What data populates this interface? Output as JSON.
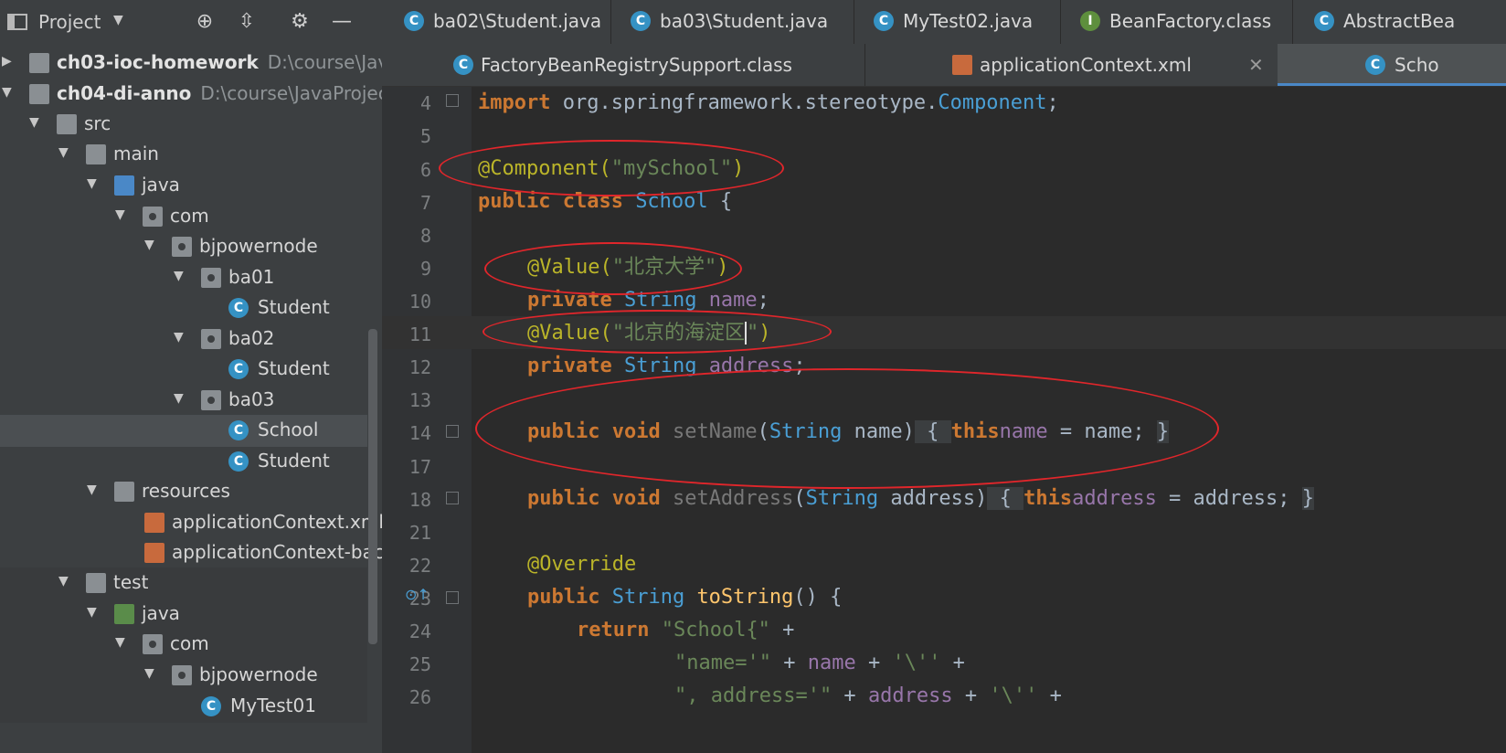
{
  "project_panel": {
    "title": "Project",
    "tree": [
      {
        "label": "ch03-ioc-homework",
        "path": "D:\\course\\JavaP",
        "kind": "module",
        "expanded": false
      },
      {
        "label": "ch04-di-anno",
        "path": "D:\\course\\JavaProjects",
        "kind": "module",
        "expanded": true
      },
      {
        "label": "src",
        "kind": "folder",
        "expanded": true
      },
      {
        "label": "main",
        "kind": "folder",
        "expanded": true
      },
      {
        "label": "java",
        "kind": "folder-source",
        "expanded": true
      },
      {
        "label": "com",
        "kind": "package",
        "expanded": true
      },
      {
        "label": "bjpowernode",
        "kind": "package",
        "expanded": true
      },
      {
        "label": "ba01",
        "kind": "package",
        "expanded": true
      },
      {
        "label": "Student",
        "kind": "class"
      },
      {
        "label": "ba02",
        "kind": "package",
        "expanded": true
      },
      {
        "label": "Student",
        "kind": "class"
      },
      {
        "label": "ba03",
        "kind": "package",
        "expanded": true
      },
      {
        "label": "School",
        "kind": "class",
        "selected": true
      },
      {
        "label": "Student",
        "kind": "class"
      },
      {
        "label": "resources",
        "kind": "folder-resources",
        "expanded": true
      },
      {
        "label": "applicationContext.xml",
        "kind": "xml"
      },
      {
        "label": "applicationContext-bac",
        "kind": "xml"
      },
      {
        "label": "test",
        "kind": "folder",
        "expanded": true
      },
      {
        "label": "java",
        "kind": "folder-test",
        "expanded": true
      },
      {
        "label": "com",
        "kind": "package",
        "expanded": true
      },
      {
        "label": "bjpowernode",
        "kind": "package",
        "expanded": true
      },
      {
        "label": "MyTest01",
        "kind": "class-test"
      }
    ]
  },
  "tabs_row1": [
    {
      "label": "ba02\\Student.java",
      "icon": "class-icon"
    },
    {
      "label": "ba03\\Student.java",
      "icon": "class-icon"
    },
    {
      "label": "MyTest02.java",
      "icon": "class-icon"
    },
    {
      "label": "BeanFactory.class",
      "icon": "interface-icon"
    },
    {
      "label": "AbstractBea",
      "icon": "class-icon"
    }
  ],
  "tabs_row2": [
    {
      "label": "FactoryBeanRegistrySupport.class",
      "icon": "class-icon"
    },
    {
      "label": "applicationContext.xml",
      "icon": "xml-icon"
    },
    {
      "label": "Scho",
      "icon": "class-icon",
      "active": true
    }
  ],
  "line_numbers": [
    "4",
    "5",
    "6",
    "7",
    "8",
    "9",
    "10",
    "11",
    "12",
    "13",
    "14",
    "17",
    "18",
    "21",
    "22",
    "23",
    "24",
    "25",
    "26"
  ],
  "code": {
    "l4": {
      "kw": "import",
      "rest": " org.springframework.stereotype.",
      "cls": "Component",
      ";": ";"
    },
    "l6": {
      "ann": "@Component(",
      "str": "\"mySchool\"",
      "end": ")"
    },
    "l7": {
      "kw": "public class ",
      "name": "School",
      " b": " {"
    },
    "l9": {
      "ann": "@Value(",
      "str": "\"北京大学\"",
      "end": ")"
    },
    "l10": {
      "kw": "private ",
      "type": "String ",
      "field": "name",
      ";": ";"
    },
    "l11": {
      "ann": "@Value(",
      "str": "\"北京的海淀区",
      "str2": "\"",
      "end": ")"
    },
    "l12": {
      "kw": "private ",
      "type": "String ",
      "field": "address",
      ";": ";"
    },
    "l14": {
      "kw": "public void ",
      "m": "setName",
      "p1": "(",
      "ptype": "String",
      " p": " name)",
      "ob": " { ",
      "this": "this",
      ".": ".",
      "fld": "name",
      " eq": " = name; ",
      "cb": "}"
    },
    "l18": {
      "kw": "public void ",
      "m": "setAddress",
      "p1": "(",
      "ptype": "String",
      " p": " address)",
      "ob": " { ",
      "this": "this",
      ".": ".",
      "fld": "address",
      " eq": " = address; ",
      "cb": "}"
    },
    "l22": {
      "ann": "@Override"
    },
    "l23": {
      "kw": "public ",
      "type": "String ",
      "m": "toString",
      "rest": "() {"
    },
    "l24": {
      "kw": "return ",
      "str": "\"School{\"",
      "rest": " +"
    },
    "l25": {
      "str": "\"name='\"",
      "plus": " + ",
      "fld": "name",
      "plus2": " + ",
      "str2": "'\\''",
      "plus3": " +"
    },
    "l26": {
      "str": "\", address='\"",
      "plus": " + ",
      "fld": "address",
      "plus2": " + ",
      "str2": "'\\''",
      "plus3": " +"
    }
  }
}
